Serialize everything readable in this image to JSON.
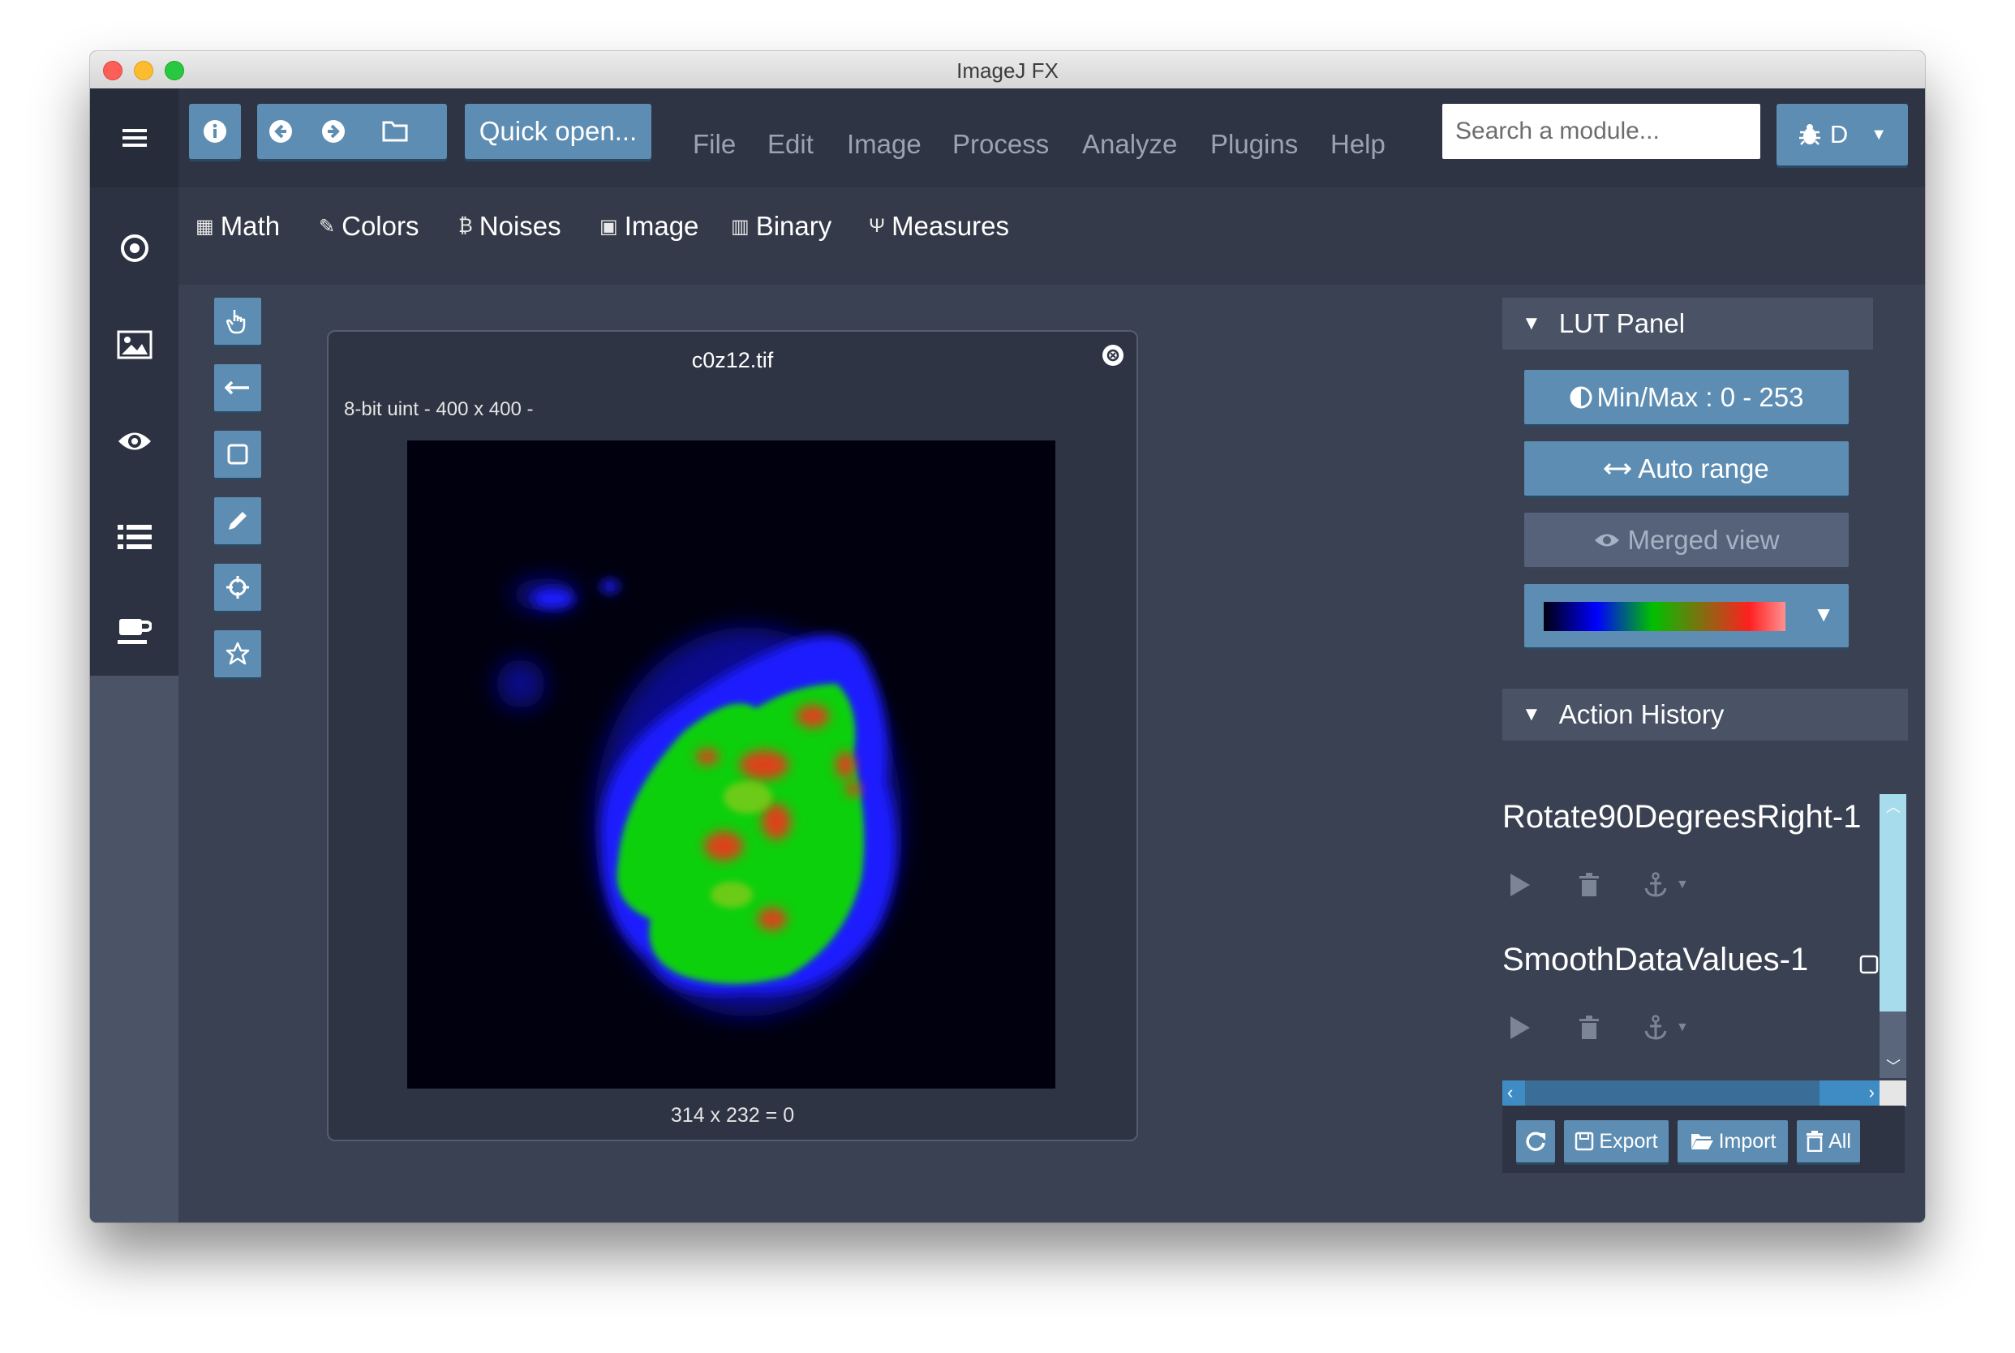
{
  "window": {
    "title": "ImageJ FX"
  },
  "toolbar": {
    "quick_open_label": "Quick open...",
    "menus": [
      "File",
      "Edit",
      "Image",
      "Process",
      "Analyze",
      "Plugins",
      "Help"
    ],
    "search_placeholder": "Search a module...",
    "debug_label": "D"
  },
  "categories": [
    {
      "label": "Math",
      "icon": "calculator-icon"
    },
    {
      "label": "Colors",
      "icon": "brush-icon"
    },
    {
      "label": "Noises",
      "icon": "bitcoin-icon"
    },
    {
      "label": "Image",
      "icon": "picture-icon"
    },
    {
      "label": "Binary",
      "icon": "barcode-icon"
    },
    {
      "label": "Measures",
      "icon": "cutlery-icon"
    }
  ],
  "image_window": {
    "filename": "c0z12.tif",
    "info": "8-bit uint - 400 x 400 -",
    "status": "314 x 232 = 0"
  },
  "lut_panel": {
    "title": "LUT Panel",
    "minmax_label": "Min/Max : 0 - 253",
    "auto_range_label": "Auto range",
    "merged_view_label": "Merged view"
  },
  "action_history": {
    "title": "Action History",
    "items": [
      {
        "name": "Rotate90DegreesRight-1"
      },
      {
        "name": "SmoothDataValues-1"
      }
    ],
    "export_label": "Export",
    "import_label": "Import",
    "all_label": "All"
  },
  "colors": {
    "accent": "#5d8db3",
    "background": "#3a4152",
    "sidebar": "#2c3241"
  }
}
